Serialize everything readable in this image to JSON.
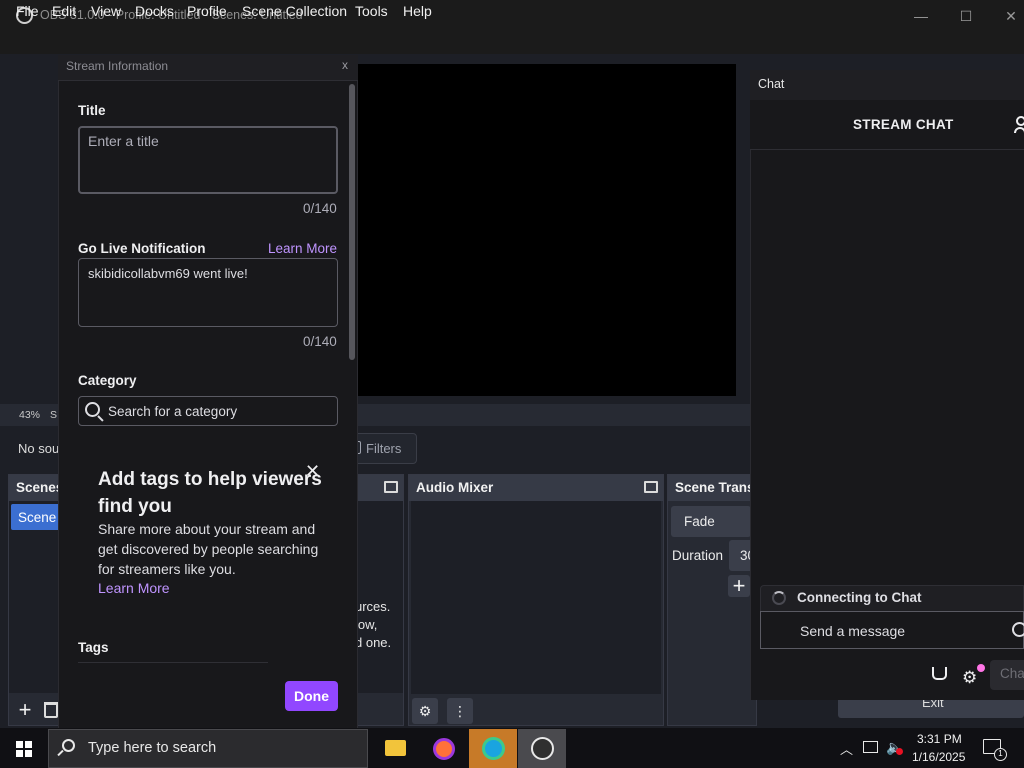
{
  "window": {
    "title": "OBS 31.0.0 - Profile: Untitled - Scenes: Untitled",
    "minimize": "—",
    "maximize": "☐",
    "close": "✕"
  },
  "menu": [
    "File",
    "Edit",
    "View",
    "Docks",
    "Profile",
    "Scene Collection",
    "Tools",
    "Help"
  ],
  "preview": {
    "zoom": "43%",
    "status_fragment": "S"
  },
  "sources_toolbar": {
    "no_source": "No sou",
    "filters": "Filters"
  },
  "docks": {
    "scenes": {
      "title": "Scenes",
      "items": [
        "Scene"
      ]
    },
    "sources": {
      "hint_lines": [
        "urces.",
        "low,",
        "d one."
      ]
    },
    "audio_mixer": {
      "title": "Audio Mixer"
    },
    "scene_transitions": {
      "title": "Scene Trans",
      "transition": "Fade",
      "duration_label": "Duration",
      "duration_value": "30"
    },
    "controls": {
      "exit": "Exit"
    }
  },
  "stream_info": {
    "header": "Stream Information",
    "close": "x",
    "title": {
      "label": "Title",
      "placeholder": "Enter a title",
      "counter": "0/140"
    },
    "go_live": {
      "label": "Go Live Notification",
      "learn_more": "Learn More",
      "value": "skibidicollabvm69 went live!",
      "counter": "0/140"
    },
    "category": {
      "label": "Category",
      "placeholder": "Search for a category"
    },
    "tags_popup": {
      "title": "Add tags to help viewers find you",
      "body": "Share more about your stream and get discovered by people searching for streamers like you.",
      "learn_more": "Learn More",
      "close": "✕"
    },
    "tags_label": "Tags",
    "done": "Done"
  },
  "chat": {
    "dock_title": "Chat",
    "title": "STREAM CHAT",
    "status": "Connecting to Chat",
    "message_placeholder": "Send a message",
    "chat_button": "Cha"
  },
  "taskbar": {
    "search_placeholder": "Type here to search",
    "time": "3:31 PM",
    "date": "1/16/2025",
    "notification_count": "1"
  },
  "colors": {
    "accent_purple": "#9147ff",
    "link_purple": "#bf94ff",
    "obs_selection": "#3b6fd1"
  }
}
